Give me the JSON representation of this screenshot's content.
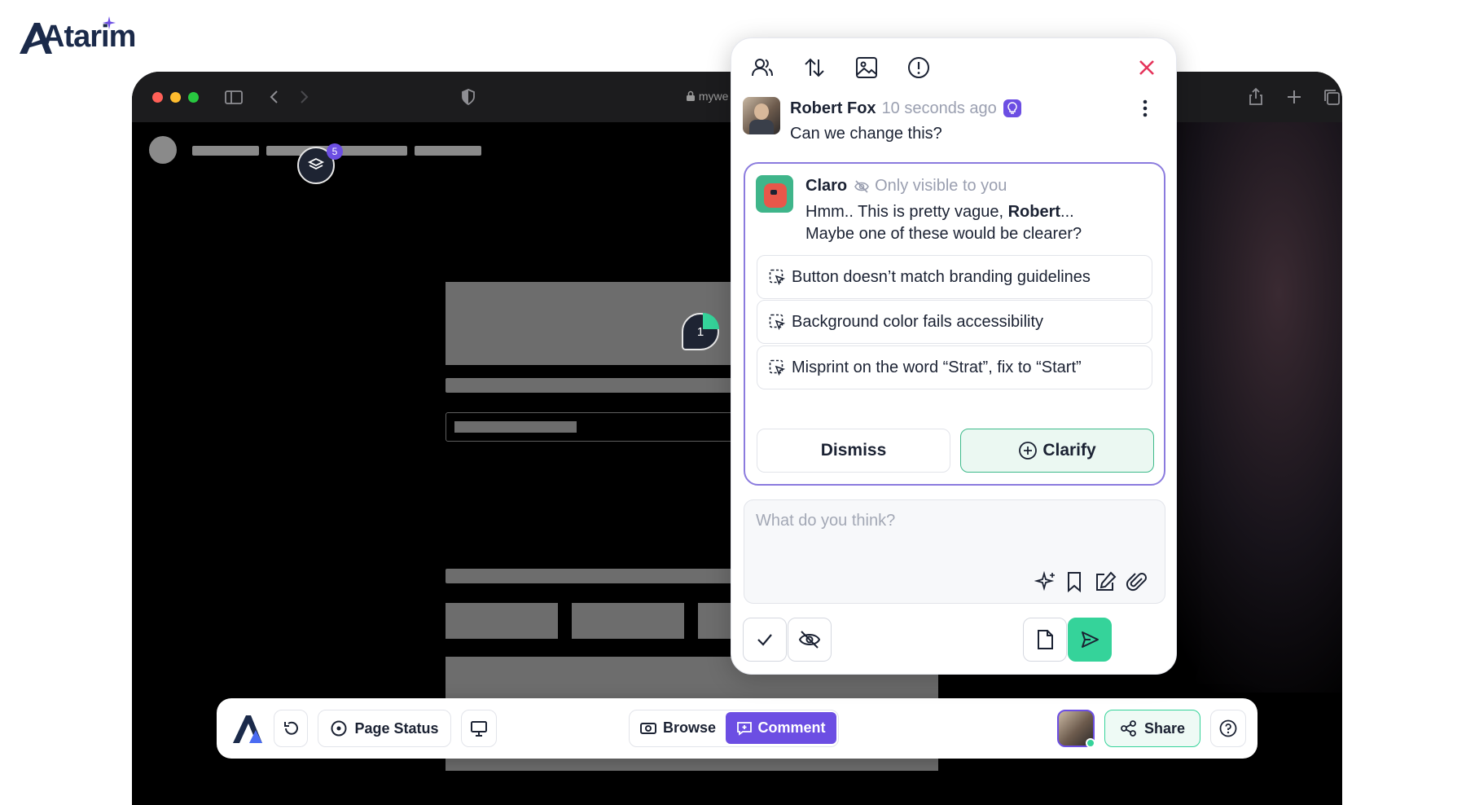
{
  "brand": {
    "name": "Atarim"
  },
  "browser": {
    "url": "mywe"
  },
  "overlay": {
    "layers_badge": "5",
    "pin_number": "1"
  },
  "toolbar": {
    "page_status": "Page Status",
    "browse": "Browse",
    "comment": "Comment",
    "share": "Share"
  },
  "comment": {
    "author": "Robert Fox",
    "time": "10 seconds ago",
    "text": "Can we change this?"
  },
  "claro": {
    "name": "Claro",
    "visibility": "Only visible to you",
    "line1_before": "Hmm.. This is pretty vague, ",
    "line1_bold": "Robert",
    "line1_after": "...",
    "line2": "Maybe one of these would be clearer?",
    "suggestions": [
      "Button doesn’t match branding guidelines",
      "Background color fails accessibility",
      "Misprint on the word “Strat”, fix to “Start”"
    ],
    "dismiss": "Dismiss",
    "clarify": "Clarify"
  },
  "compose": {
    "placeholder": "What do you think?"
  },
  "colors": {
    "accent": "#6c4ee3",
    "success": "#35d39a",
    "danger": "#e5345b"
  },
  "icons": [
    "users-icon",
    "sort-icon",
    "image-icon",
    "alert-icon",
    "close-icon",
    "kebab-icon",
    "eye-off-icon",
    "sparkle-icon",
    "bookmark-icon",
    "edit-icon",
    "paperclip-icon",
    "check-icon",
    "file-icon",
    "send-icon"
  ]
}
